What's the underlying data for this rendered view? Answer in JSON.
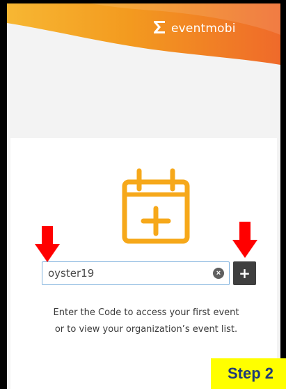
{
  "brand": {
    "name": "eventmobi",
    "logo_icon": "sigma-logo-icon",
    "colors": {
      "orange": "#f28b1c",
      "yellow": "#f7b733",
      "red_orange": "#ef6a2a"
    }
  },
  "main": {
    "icon": "calendar-plus-icon",
    "icon_color": "#f6a81a",
    "code_input": {
      "value": "oyster19",
      "placeholder": ""
    },
    "clear_icon": "x-circle-icon",
    "add_button": {
      "label": "+",
      "icon": "plus-icon"
    },
    "help_text": "Enter the Code to access your first event or to view your organization’s event list."
  },
  "annotations": {
    "arrow_color": "#ff0000",
    "step_label": "Step 2",
    "step_bg": "#ffff00"
  }
}
